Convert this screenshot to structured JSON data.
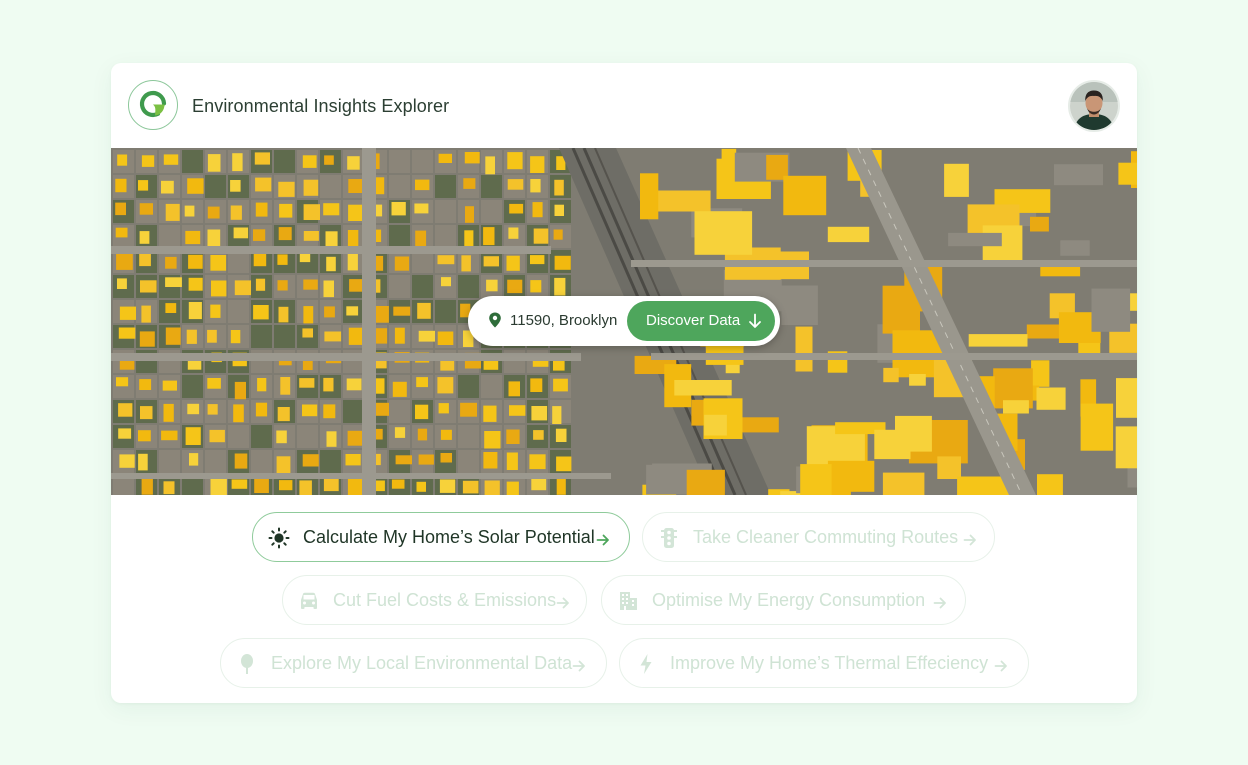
{
  "app": {
    "title": "Environmental Insights Explorer",
    "logo_icon": "g-leaf-logo-icon",
    "avatar_icon": "user-avatar"
  },
  "search": {
    "location": "11590, Brooklyn",
    "location_icon": "map-pin-icon",
    "discover_label": "Discover Data",
    "discover_icon": "arrow-down-icon"
  },
  "actions": [
    {
      "label": "Calculate My Home’s Solar Potential",
      "icon": "sun-icon",
      "active": true
    },
    {
      "label": "Take Cleaner Commuting Routes",
      "icon": "traffic-light-icon",
      "active": false
    },
    {
      "label": "Cut Fuel Costs & Emissions",
      "icon": "car-icon",
      "active": false
    },
    {
      "label": "Optimise My Energy Consumption",
      "icon": "building-icon",
      "active": false
    },
    {
      "label": "Explore My Local Environmental Data",
      "icon": "tree-icon",
      "active": false
    },
    {
      "label": "Improve My Home’s Thermal Effeciency",
      "icon": "lightning-icon",
      "active": false
    }
  ],
  "colors": {
    "background": "#effcf2",
    "accent": "#4ea65c",
    "chip_border_active": "#8fcb9b",
    "chip_text_inactive": "#cfe3d4",
    "solar_roof": "#f5c518"
  }
}
